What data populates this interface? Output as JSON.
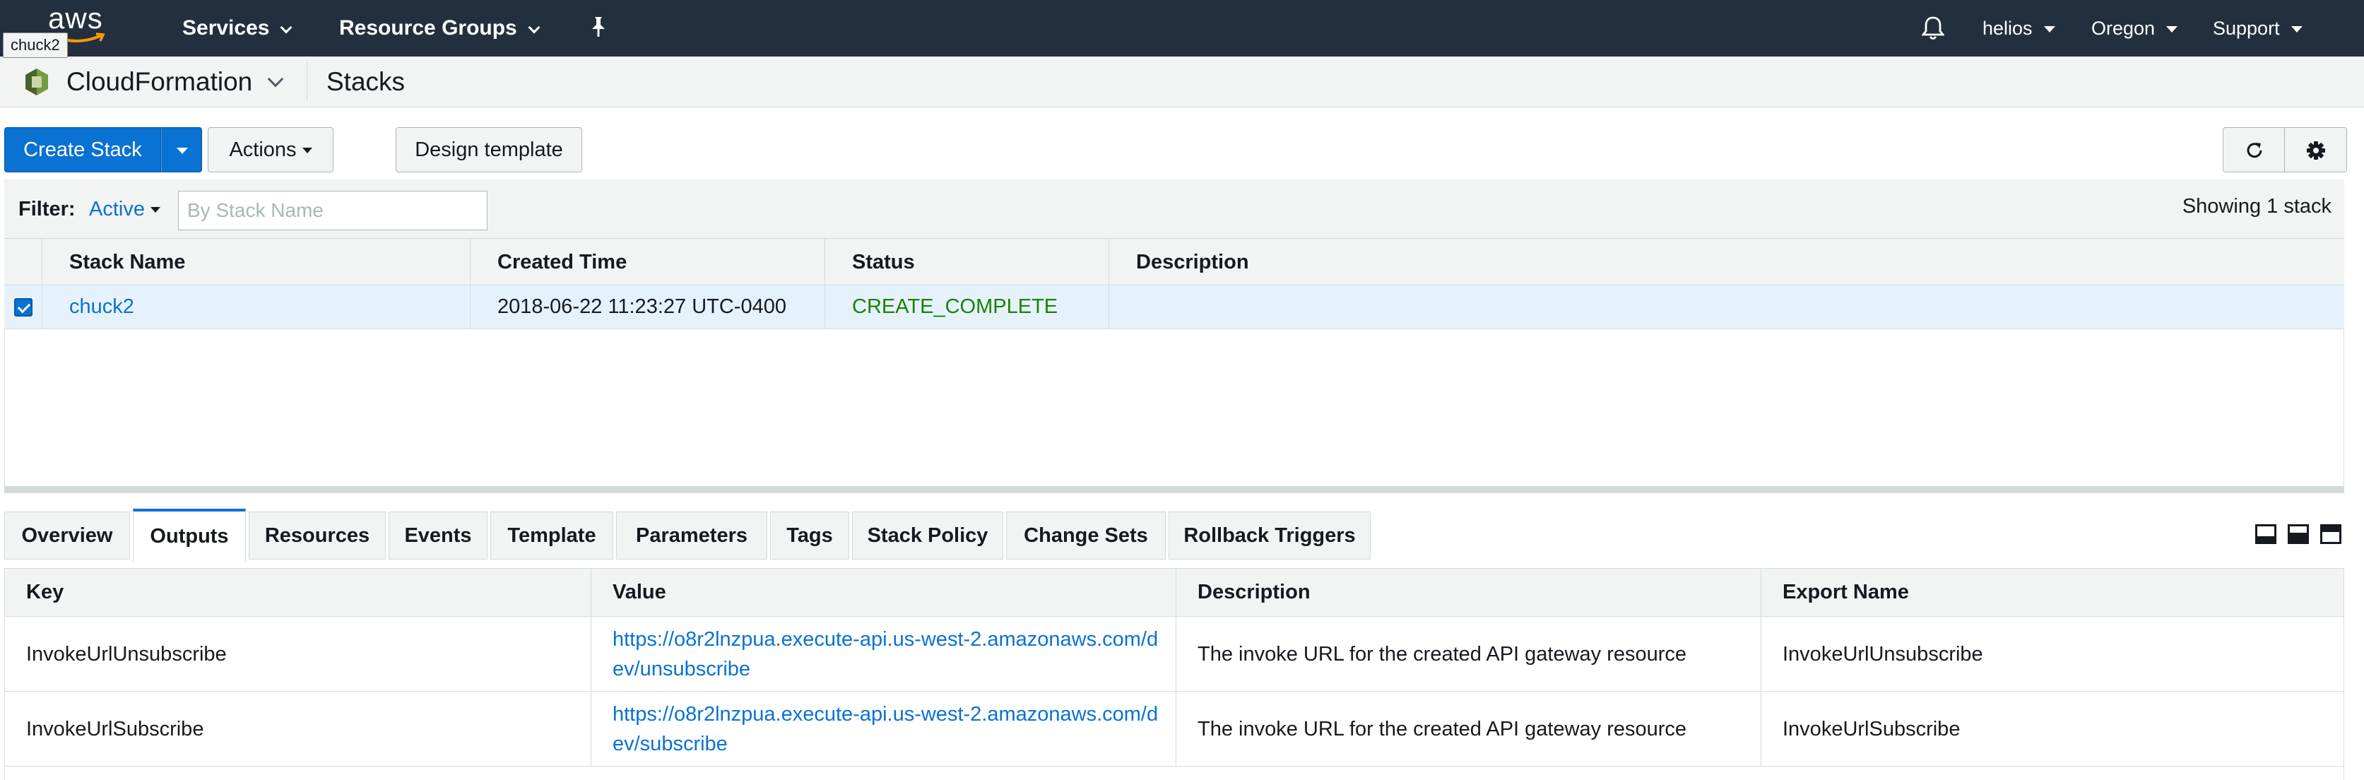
{
  "topnav": {
    "logo_text": "aws",
    "tooltip": "chuck2",
    "services_label": "Services",
    "resource_groups_label": "Resource Groups",
    "user_label": "helios",
    "region_label": "Oregon",
    "support_label": "Support",
    "icons": [
      "aws-smile-icon",
      "pin-icon",
      "bell-icon"
    ]
  },
  "service_header": {
    "service_name": "CloudFormation",
    "page_name": "Stacks",
    "icon": "cloudformation-icon"
  },
  "toolbar": {
    "create_stack_label": "Create Stack",
    "actions_label": "Actions",
    "design_template_label": "Design template",
    "icons": [
      "refresh-icon",
      "gear-icon"
    ]
  },
  "filter": {
    "label": "Filter:",
    "active_value": "Active",
    "search_placeholder": "By Stack Name",
    "showing_text": "Showing 1 stack"
  },
  "stacks_table": {
    "columns": [
      "Stack Name",
      "Created Time",
      "Status",
      "Description"
    ],
    "rows": [
      {
        "selected": true,
        "stack_name": "chuck2",
        "created_time": "2018-06-22 11:23:27 UTC-0400",
        "status": "CREATE_COMPLETE",
        "description": ""
      }
    ]
  },
  "tabs": {
    "items": [
      "Overview",
      "Outputs",
      "Resources",
      "Events",
      "Template",
      "Parameters",
      "Tags",
      "Stack Policy",
      "Change Sets",
      "Rollback Triggers"
    ],
    "active": "Outputs"
  },
  "outputs_table": {
    "columns": [
      "Key",
      "Value",
      "Description",
      "Export Name"
    ],
    "rows": [
      {
        "key": "InvokeUrlUnsubscribe",
        "value": "https://o8r2lnzpua.execute-api.us-west-2.amazonaws.com/dev/unsubscribe",
        "description": "The invoke URL for the created API gateway resource",
        "export_name": "InvokeUrlUnsubscribe"
      },
      {
        "key": "InvokeUrlSubscribe",
        "value": "https://o8r2lnzpua.execute-api.us-west-2.amazonaws.com/dev/subscribe",
        "description": "The invoke URL for the created API gateway resource",
        "export_name": "InvokeUrlSubscribe"
      }
    ]
  },
  "colors": {
    "nav_bg": "#232f3e",
    "primary": "#0972d3",
    "link": "#0972d3",
    "status_success": "#1d8102",
    "selected_row": "#e6f2fb",
    "header_bg": "#f2f3f3"
  }
}
